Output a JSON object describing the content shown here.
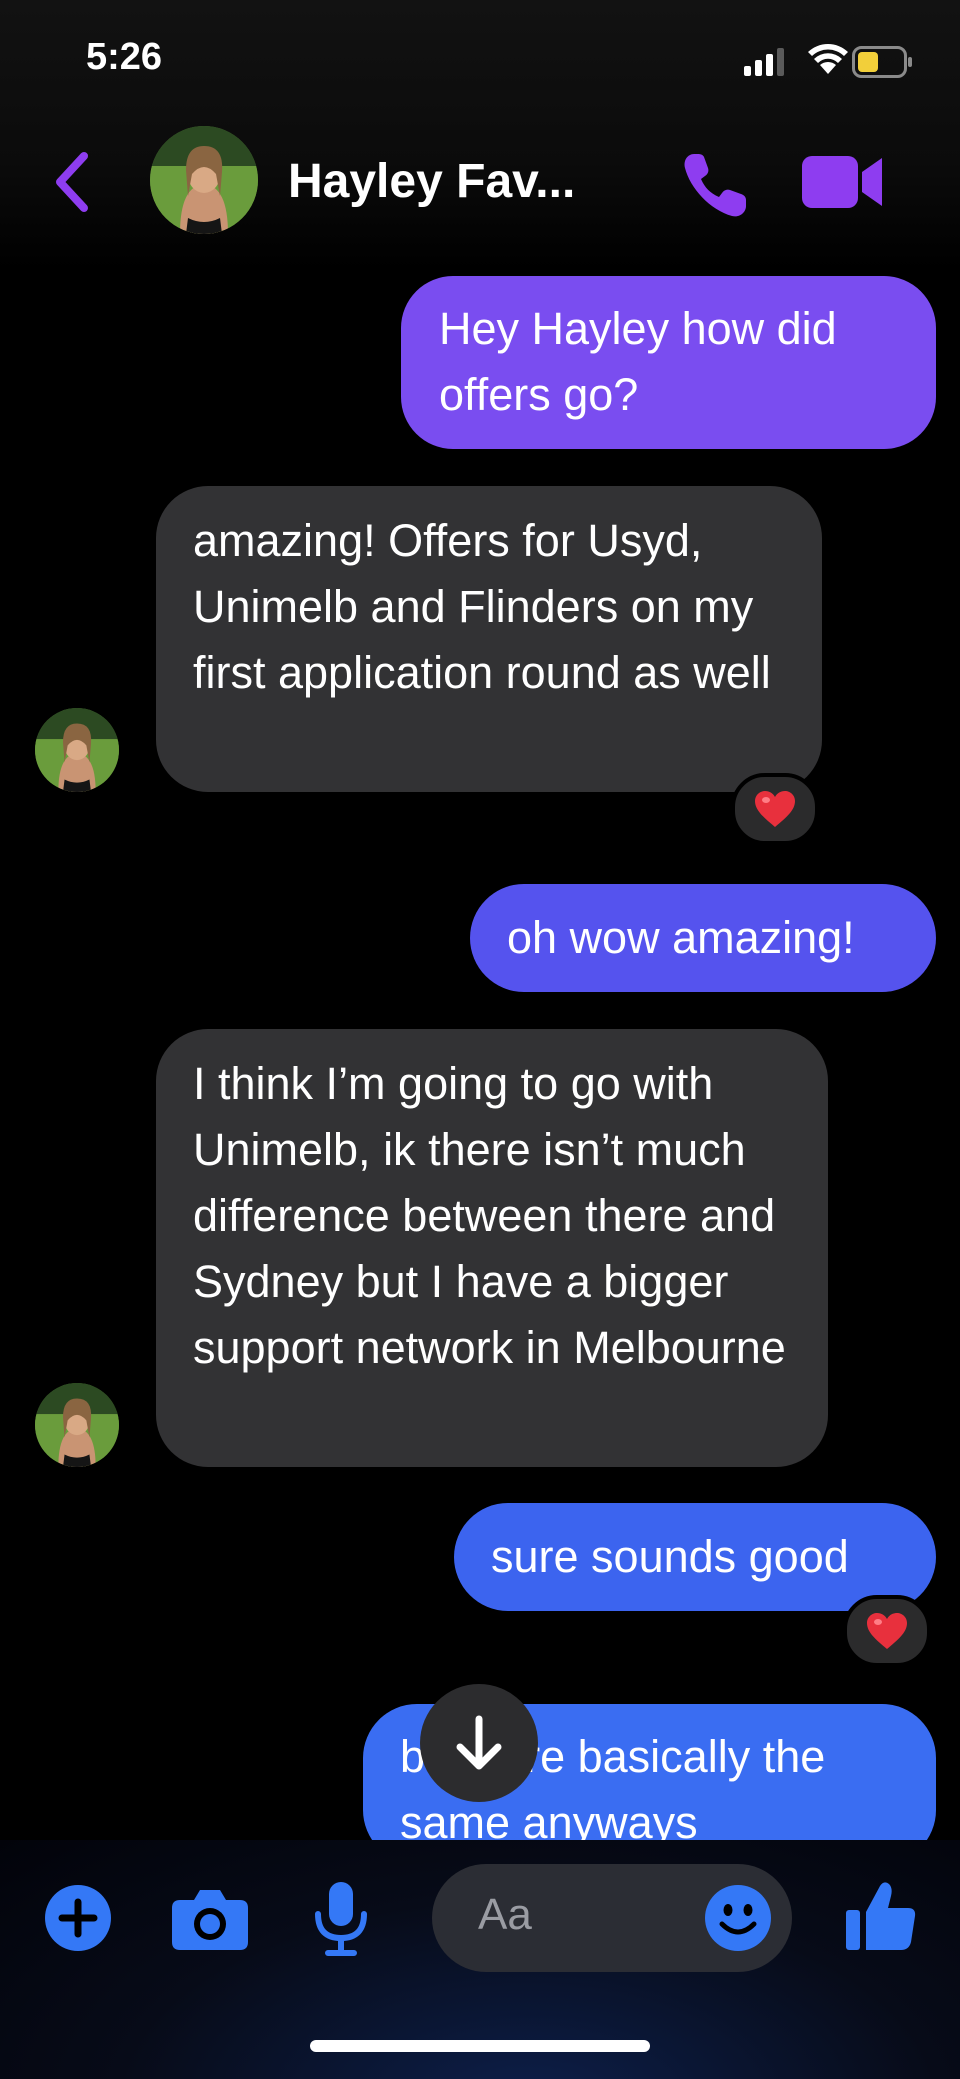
{
  "status_bar": {
    "time": "5:26",
    "battery_color": "#f2cf3a"
  },
  "header": {
    "contact_name": "Hayley Fav...",
    "accent_color": "#8e3df0",
    "icons": [
      "chevron-left-icon",
      "phone-icon",
      "video-camera-icon"
    ]
  },
  "messages": [
    {
      "direction": "outgoing",
      "text": "Hey Hayley how did offers go?",
      "color": "#7a4df0"
    },
    {
      "direction": "incoming",
      "text": "amazing! Offers for Usyd, Unimelb and Flinders on my first application round as well",
      "reaction": "❤️"
    },
    {
      "direction": "outgoing",
      "text": "oh wow amazing!",
      "color": "#5553ee"
    },
    {
      "direction": "incoming",
      "text": "I think I’m going to go with Unimelb, ik there isn’t much difference between there and Sydney but I have a bigger support network in Melbourne"
    },
    {
      "direction": "outgoing",
      "text": "sure sounds good",
      "color": "#3c64ef",
      "reaction": "❤️"
    },
    {
      "direction": "outgoing",
      "text": "both are basically the same anyways",
      "color": "#3a6df2"
    }
  ],
  "composer": {
    "placeholder": "Aa",
    "accent_color": "#3478f6",
    "icons": [
      "plus-icon",
      "camera-icon",
      "microphone-icon",
      "emoji-icon",
      "thumbs-up-icon"
    ]
  }
}
